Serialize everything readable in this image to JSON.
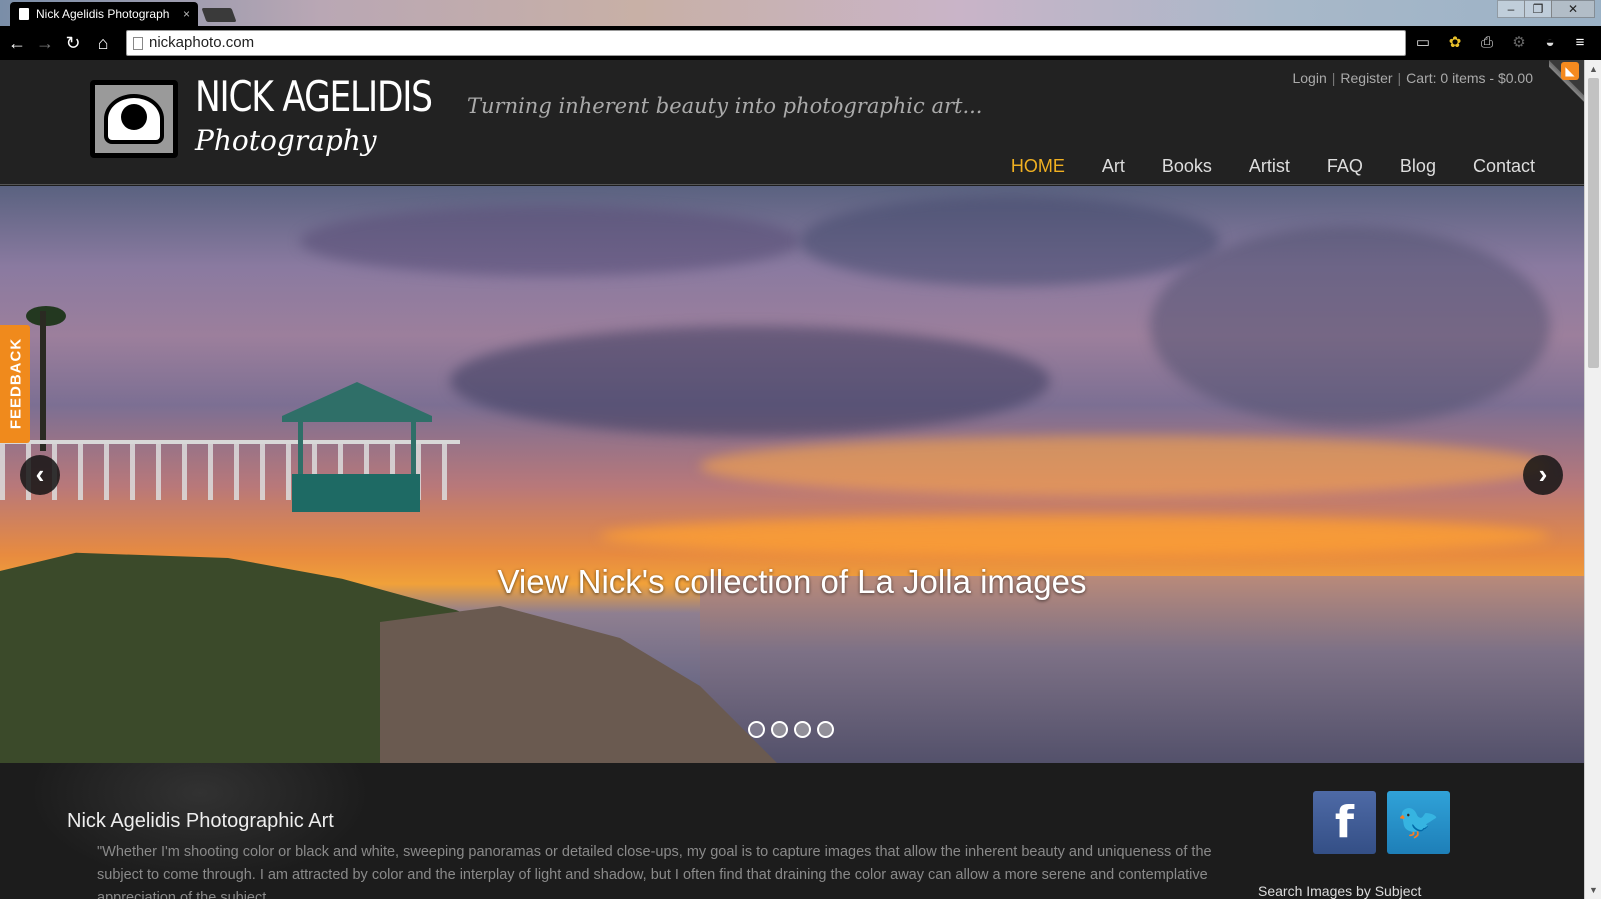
{
  "browser": {
    "tab_title": "Nick Agelidis Photograph",
    "tab_close": "×",
    "address": "nickaphoto.com",
    "window_buttons": [
      "–",
      "❐",
      "✕"
    ]
  },
  "header": {
    "brand_name": "NICK AGELIDIS",
    "brand_sub": "Photography",
    "tagline": "Turning inherent beauty into photographic art...",
    "user_links": {
      "login": "Login",
      "register": "Register",
      "cart": "Cart: 0 items - $0.00",
      "sep": "|"
    },
    "nav": [
      {
        "label": "HOME",
        "active": true
      },
      {
        "label": "Art"
      },
      {
        "label": "Books"
      },
      {
        "label": "Artist"
      },
      {
        "label": "FAQ"
      },
      {
        "label": "Blog"
      },
      {
        "label": "Contact"
      }
    ]
  },
  "hero": {
    "caption": "View Nick's collection of La Jolla images",
    "slide_count": 4,
    "active_slide": 1,
    "prev_arrow": "‹",
    "next_arrow": "›"
  },
  "feedback": {
    "label": "FEEDBACK"
  },
  "content": {
    "title": "Nick Agelidis Photographic Art",
    "text": "\"Whether I'm shooting color or black and white, sweeping panoramas or detailed close-ups, my goal is to capture images that allow the inherent beauty and uniqueness of the subject to come through. I am attracted by color and the interplay of light and shadow, but I often find that draining the color away can allow a more serene and contemplative appreciation of the subject.",
    "social": {
      "facebook": "f",
      "twitter": "🐦"
    },
    "search_label": "Search Images by Subject"
  },
  "colors": {
    "accent": "#f0b021",
    "feedback": "#f08a1c",
    "facebook": "#3b5998",
    "twitter": "#29a0d8"
  }
}
